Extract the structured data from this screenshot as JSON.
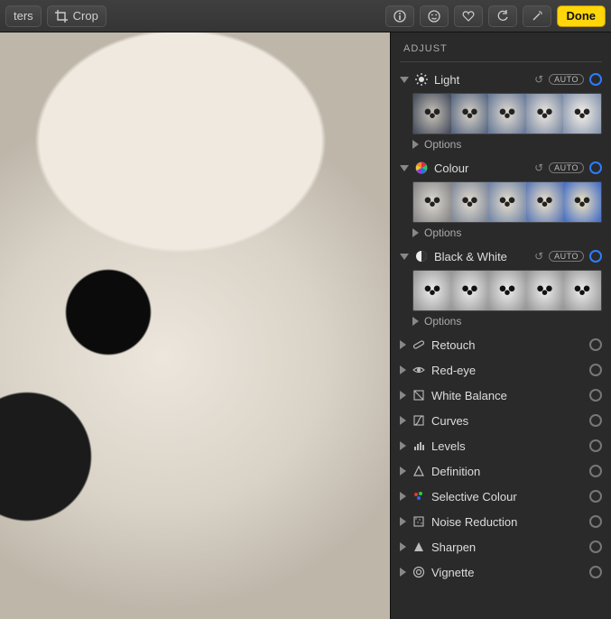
{
  "toolbar": {
    "filters_btn": "ters",
    "crop_btn": "Crop",
    "done_btn": "Done"
  },
  "panel": {
    "title": "ADJUST",
    "options_label": "Options",
    "auto_label": "AUTO",
    "sections": {
      "light": {
        "label": "Light",
        "expanded": true
      },
      "colour": {
        "label": "Colour",
        "expanded": true
      },
      "bw": {
        "label": "Black & White",
        "expanded": true
      },
      "retouch": {
        "label": "Retouch",
        "expanded": false
      },
      "redeye": {
        "label": "Red-eye",
        "expanded": false
      },
      "white_balance": {
        "label": "White Balance",
        "expanded": false
      },
      "curves": {
        "label": "Curves",
        "expanded": false
      },
      "levels": {
        "label": "Levels",
        "expanded": false
      },
      "definition": {
        "label": "Definition",
        "expanded": false
      },
      "selective": {
        "label": "Selective Colour",
        "expanded": false
      },
      "noise": {
        "label": "Noise Reduction",
        "expanded": false
      },
      "sharpen": {
        "label": "Sharpen",
        "expanded": false
      },
      "vignette": {
        "label": "Vignette",
        "expanded": false
      }
    }
  }
}
